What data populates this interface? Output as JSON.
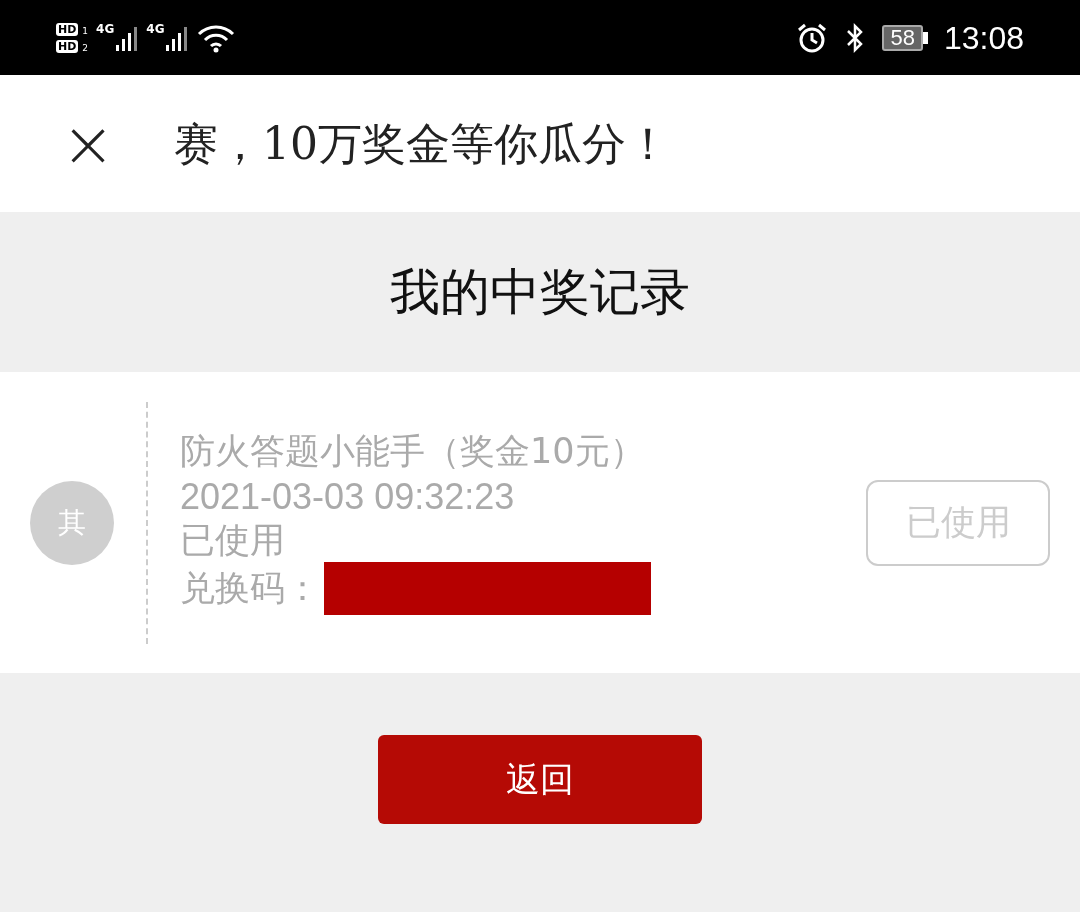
{
  "status_bar": {
    "sims": [
      {
        "hd": "HD",
        "slot": "1",
        "network": "4G"
      },
      {
        "hd": "HD",
        "slot": "2",
        "network": "4G"
      }
    ],
    "battery": "58",
    "time": "13:08"
  },
  "header": {
    "close": "×",
    "title": "赛，10万奖金等你瓜分！"
  },
  "page_title": "我的中奖记录",
  "records": [
    {
      "avatar": "其",
      "name": "防火答题小能手（奖金10元）",
      "time": "2021-03-03 09:32:23",
      "status": "已使用",
      "code_label": "兑换码：",
      "redacted": true,
      "button": "已使用",
      "disabled": true
    }
  ],
  "back_button": "返回"
}
